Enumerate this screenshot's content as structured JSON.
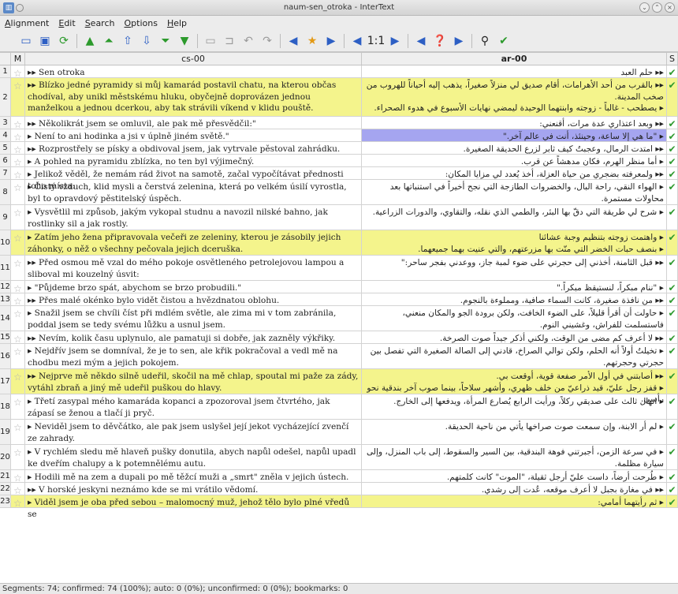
{
  "window": {
    "title": "naum-sen_otroka - InterText"
  },
  "menu": [
    "Alignment",
    "Edit",
    "Search",
    "Options",
    "Help"
  ],
  "columns": {
    "m": "M",
    "cs": "cs-00",
    "ar": "ar-00",
    "s": "S"
  },
  "rows": [
    {
      "n": "1",
      "cs": "▸▸ Sen otroka",
      "ar": "▸▸ حلم العبد",
      "h": 15,
      "hl": false
    },
    {
      "n": "2",
      "cs": "▸▸ Blízko jedné pyramidy si můj kamarád postavil chatu, na kterou občas chodíval, aby unikl městskému hluku, obyčejně doprovázen jednou manželkou a jednou dcerkou, aby tak strávili víkend v klidu pouště.",
      "ar": "▸▸ بالقرب من أحد الأهرامات، أقام صديق لي منزلاً صغيراً، يذهب إليه أحياناً للهروب من صخب المدينة.\n▸ يصطحب - غالباً - زوجته وابنتهما الوحيدة ليمضي نهايات الأسبوع في هدوء الصحراء.",
      "h": 48,
      "hl": true
    },
    {
      "n": "3",
      "cs": "▸▸ Několikrát jsem se omluvil, ale pak mě přesvědčil:\"",
      "ar": "▸▸ وبعد اعتذاري عدة مرات، أقنعني:",
      "h": 15,
      "hl": false
    },
    {
      "n": "4",
      "cs": "▸ Není to ani hodinka a jsi v úplně jiném světě.\"",
      "ar": "▸ \"ما هي إلا ساعة، وحينئذ، أنت في عالم آخر.\"",
      "h": 15,
      "hl": false,
      "sel": true
    },
    {
      "n": "5",
      "cs": "▸▸ Rozprostřely se písky a obdivoval jsem, jak vytrvale pěstoval zahrádku.",
      "ar": "▸▸ امتدت الرمال، وعجبتُ كيف ثابر لزرع الحديقة الصغيرة.",
      "h": 15,
      "hl": false
    },
    {
      "n": "6",
      "cs": "▸ A pohled na pyramidu zblízka, no ten byl výjimečný.",
      "ar": "▸ أما منظر الهرم، فكان مدهشاً عن قرب.",
      "h": 15,
      "hl": false
    },
    {
      "n": "7",
      "cs": "▸ Jelikož věděl, že nemám rád život na samotě, začal vypočítávat přednosti toho místa:",
      "ar": "▸▸ ولمعرفته بضجري من حياة العزلة، أخذ يُعدد لي مزايا المكان:",
      "h": 15,
      "hl": false
    },
    {
      "n": "8",
      "cs": "▸ Čistý vzduch, klid mysli a čerstvá zelenina, která po velkém úsilí vyrostla, byl to opravdový pěstitelský úspěch.",
      "ar": "▸ الهواء النقي، راحة البال، والخضروات الطازجة التي نجح أخيراً في استنباتها بعد محاولات مستمرة.",
      "h": 31,
      "hl": false
    },
    {
      "n": "9",
      "cs": "▸ Vysvětlil mi způsob, jakým vykopal studnu a navozil nilské bahno, jak rostlinky sil a jak rostly.",
      "ar": "▸ شرح لي طريقة التي دقّ بها البئر، والطمي الذي نقله، والتقاوي، والدورات الزراعية.",
      "h": 31,
      "hl": false
    },
    {
      "n": "10",
      "cs": "▸ Zatím jeho žena připravovala večeři ze zeleniny, kterou je zásobily jejich záhonky, o něž o všechny pečovala jejich dceruška.",
      "ar": "▸ واهتمت زوجته بتنظيم وجبة عشائنا\n▸ بنصف حبات الخضر التي منّت بها مزرعتهم، والتي عنيت بهما جميعهما.",
      "h": 31,
      "hl": true
    },
    {
      "n": "11",
      "cs": "▸▸ Před osmou mě vzal do mého pokoje osvětleného petrolejovou lampou a sliboval mi kouzelný úsvit:",
      "ar": "▸▸ قبل الثامنة، أخذني إلى حجرتي على ضوء لمبة جاز، ووعدني بفجر ساحر:\"",
      "h": 31,
      "hl": false
    },
    {
      "n": "12",
      "cs": "▸ \"Půjdeme brzo spát, abychom se brzo probudili.\"",
      "ar": "▸ \"ننام مبكراً، لنستيقظ مبكراً.\"",
      "h": 15,
      "hl": false
    },
    {
      "n": "13",
      "cs": "▸▸ Přes malé okénko bylo vidět čistou a hvězdnatou oblohu.",
      "ar": "▸▸ من نافذة صغيرة، كانت السماء صافية، ومملوءة بالنجوم.",
      "h": 15,
      "hl": false
    },
    {
      "n": "14",
      "cs": "▸ Snažil jsem se chvíli číst při mdlém světle, ale zima mi v tom zabránila, poddal jsem se tedy svému lůžku a usnul jsem.",
      "ar": "▸ حاولت أن أقرأ قليلاً، على الضوء الخافت، ولكن برودة الجو والمكان منعني، فاستسلمت للفراش، وغشيني النوم.",
      "h": 31,
      "hl": false
    },
    {
      "n": "15",
      "cs": "▸▸ Nevím, kolik času uplynulo, ale pamatuji si dobře, jak zazněly výkřiky.",
      "ar": "▸▸ لا أعرف كم مضى من الوقت، ولكني أذكر جيداً صوت الصرخة.",
      "h": 15,
      "hl": false
    },
    {
      "n": "16",
      "cs": "▸ Nejdřív jsem se domníval, že je to sen, ale křik pokračoval a vedl mě na chodbu mezi mým a jejich pokojem.",
      "ar": "▸ تخيلتُ أولاً أنه الحلم، ولكن توالي الصراخ، قادني إلى الصالة الصغيرة التي تفصل بين حجرتي وحجرتهم.",
      "h": 31,
      "hl": false
    },
    {
      "n": "17",
      "cs": "▸▸ Nejprve mě někdo silně udeřil, skočil na mě chlap, spoutal mi paže za zády, vytáhl zbraň a jiný mě udeřil puškou do hlavy.",
      "ar": "▸▸ أصابتني في أول الأمر صفعة قوية، أوقعت بي.\n▸ قفز رجل عليّ، قيد ذراعيّ من خلف ظهري، وأشهر سلاحاً، بينما صوب آخر بندقية نحو رأسي.",
      "h": 31,
      "hl": true
    },
    {
      "n": "18",
      "cs": "▸ Třetí zasypal mého kamaráda kopanci a zpozoroval jsem čtvrtého, jak zápasí se ženou a tlačí ji pryč.",
      "ar": "▸ انهال ثالث على صديقي ركلاً، ورأيت الرابع يُصارع المرأة، ويدفعها إلى الخارج.",
      "h": 31,
      "hl": false
    },
    {
      "n": "19",
      "cs": "▸ Neviděl jsem to děvčátko, ale pak jsem uslyšel její jekot vycházející zvenčí ze zahrady.",
      "ar": "▸ لم أر الابنة، وإن سمعت صوت صراخها يأتي من ناحية الحديقة.",
      "h": 31,
      "hl": false
    },
    {
      "n": "20",
      "cs": "▸ V rychlém sledu mě hlaveň pušky donutila, abych napůl odešel, napůl upadl ke dveřím chalupy a k potemnělému autu.",
      "ar": "▸ في سرعة الزمن، أجبرتني فوهة البندقية، بين السير والسقوط، إلى باب المنزل، وإلى سيارة مظلمة.",
      "h": 31,
      "hl": false
    },
    {
      "n": "21",
      "cs": "▸ Hodili mě na zem a dupali po mě těžcí muži a „smrt\" zněla v jejich ústech.",
      "ar": "▸ طُرحت أرضاً، داست عليّ أرجل ثقيلة، \"الموت\" كانت كلمتهم.",
      "h": 15,
      "hl": false
    },
    {
      "n": "22",
      "cs": "▸▸ V horské jeskyni neznámo kde se mi vrátilo vědomí.",
      "ar": "▸▸ في مغارة بجبل لا أعرف موقعه، عُدت إلى رشدي.",
      "h": 15,
      "hl": false
    },
    {
      "n": "23",
      "cs": "▸ Viděl jsem je oba před sebou – malomocný muž, jehož tělo bylo plné vředů se",
      "ar": "▸ ثم رأيتهما أمامي:",
      "h": 15,
      "hl": true
    }
  ],
  "status": "Segments: 74; confirmed: 74 (100%); auto: 0 (0%); unconfirmed: 0 (0%); bookmarks: 0"
}
